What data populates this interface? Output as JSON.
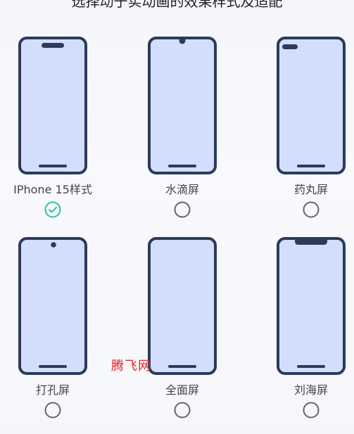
{
  "header": {
    "title": "选择动于实动画的效果样式及适配"
  },
  "options": [
    {
      "label": "IPhone 15样式",
      "cutout": "pill",
      "selected": true
    },
    {
      "label": "水滴屏",
      "cutout": "waterdrop",
      "selected": false
    },
    {
      "label": "药丸屏",
      "cutout": "corner-pill",
      "selected": false
    },
    {
      "label": "打孔屏",
      "cutout": "punch-hole",
      "selected": false
    },
    {
      "label": "全面屏",
      "cutout": "none",
      "selected": false
    },
    {
      "label": "刘海屏",
      "cutout": "notch",
      "selected": false
    }
  ],
  "watermark": "腾飞网",
  "colors": {
    "frame": "#2c3a5c",
    "screen": "#d3defd",
    "accent": "#2fbfa5",
    "radio_border": "#666666"
  }
}
